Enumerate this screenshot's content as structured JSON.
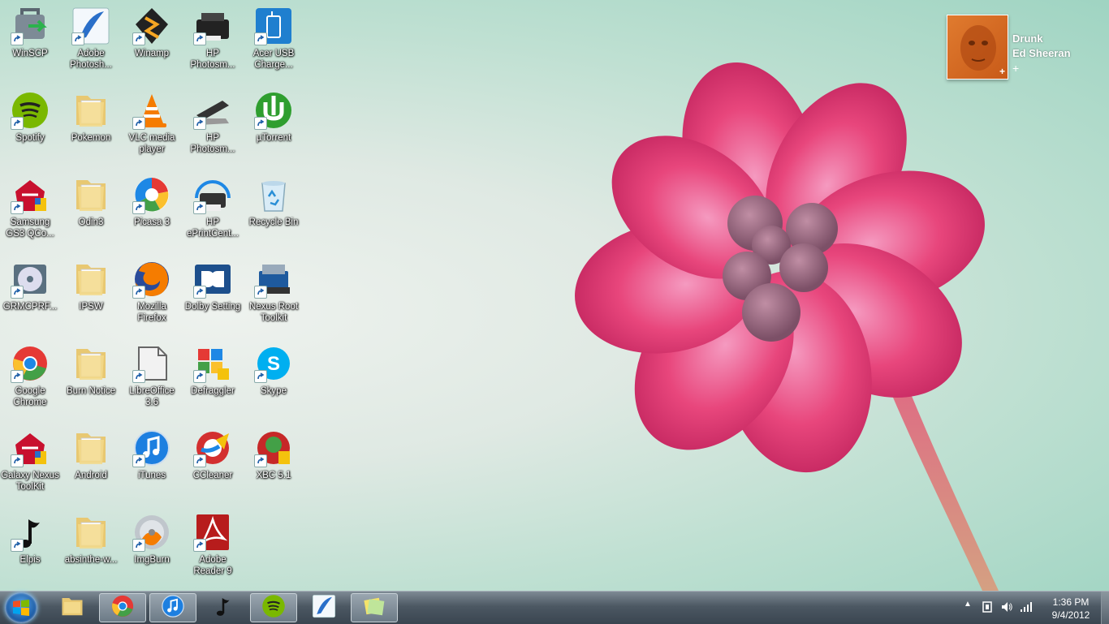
{
  "desktop": {
    "icons": [
      {
        "label": "WinSCP",
        "icon": "winscp-icon"
      },
      {
        "label": "Adobe\nPhotosh...",
        "icon": "photoshop-icon"
      },
      {
        "label": "Winamp",
        "icon": "winamp-icon"
      },
      {
        "label": "HP\nPhotosm...",
        "icon": "hp-photosmart-icon"
      },
      {
        "label": "Acer USB\nCharge...",
        "icon": "acer-usb-icon"
      },
      {
        "label": "Spotify",
        "icon": "spotify-icon"
      },
      {
        "label": "Pokemon",
        "icon": "folder-icon"
      },
      {
        "label": "VLC media\nplayer",
        "icon": "vlc-icon"
      },
      {
        "label": "HP\nPhotosm...",
        "icon": "scanner-icon"
      },
      {
        "label": "µTorrent",
        "icon": "utorrent-icon"
      },
      {
        "label": "Samsung\nGS3 QCo...",
        "icon": "toolkit-icon"
      },
      {
        "label": "Odin3",
        "icon": "folder-icon"
      },
      {
        "label": "Picasa 3",
        "icon": "picasa-icon"
      },
      {
        "label": "HP\nePrintCent...",
        "icon": "printer-icon"
      },
      {
        "label": "Recycle Bin",
        "icon": "recycle-bin-icon"
      },
      {
        "label": "GRMCPRF...",
        "icon": "disc-image-icon"
      },
      {
        "label": "IPSW",
        "icon": "folder-icon"
      },
      {
        "label": "Mozilla\nFirefox",
        "icon": "firefox-icon"
      },
      {
        "label": "Dolby Setting",
        "icon": "dolby-icon"
      },
      {
        "label": "Nexus Root\nToolkit",
        "icon": "nexus-root-icon"
      },
      {
        "label": "Google\nChrome",
        "icon": "chrome-icon"
      },
      {
        "label": "Burn Notice",
        "icon": "folder-icon"
      },
      {
        "label": "LibreOffice\n3.6",
        "icon": "libreoffice-icon"
      },
      {
        "label": "Defraggler",
        "icon": "defraggler-icon"
      },
      {
        "label": "Skype",
        "icon": "skype-icon"
      },
      {
        "label": "Galaxy Nexus\nToolKit",
        "icon": "toolkit-icon"
      },
      {
        "label": "Android",
        "icon": "folder-icon"
      },
      {
        "label": "iTunes",
        "icon": "itunes-icon"
      },
      {
        "label": "CCleaner",
        "icon": "ccleaner-icon"
      },
      {
        "label": "XBC 5.1",
        "icon": "xbmc-icon"
      },
      {
        "label": "Elpis",
        "icon": "music-note-icon"
      },
      {
        "label": "absinthe-w...",
        "icon": "folder-icon"
      },
      {
        "label": "ImgBurn",
        "icon": "imgburn-icon"
      },
      {
        "label": "Adobe\nReader 9",
        "icon": "adobe-reader-icon"
      }
    ]
  },
  "now_playing": {
    "title": "Drunk",
    "artist": "Ed Sheeran",
    "plus": "+"
  },
  "taskbar": {
    "items": [
      {
        "icon": "explorer-icon",
        "active": false
      },
      {
        "icon": "chrome-icon",
        "active": true
      },
      {
        "icon": "itunes-icon",
        "active": true
      },
      {
        "icon": "music-note-icon",
        "active": false
      },
      {
        "icon": "spotify-icon",
        "active": true
      },
      {
        "icon": "photoshop-icon",
        "active": false
      },
      {
        "icon": "sticky-notes-icon",
        "active": true
      }
    ],
    "clock": {
      "time": "1:36 PM",
      "date": "9/4/2012"
    }
  },
  "colors": {
    "spotify": "#7ab800",
    "taskbar": "#4c5863",
    "flower": "#e8467c"
  }
}
